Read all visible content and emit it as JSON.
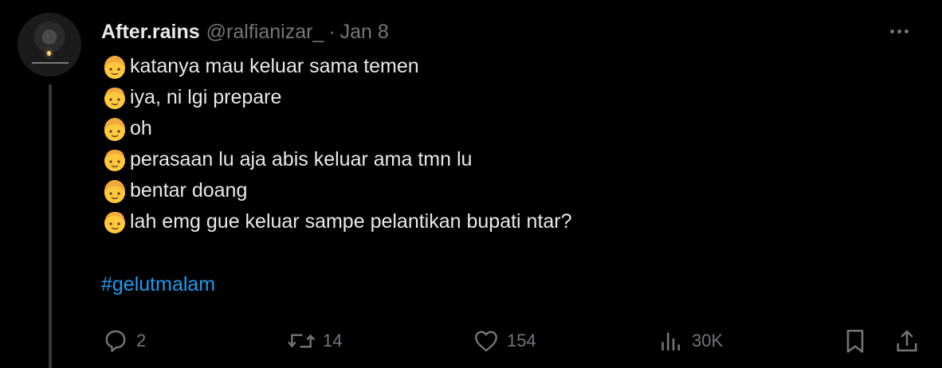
{
  "author": {
    "name": "After.rains",
    "handle": "@ralfianizar_",
    "separator": "·",
    "date": "Jan 8"
  },
  "tweet": {
    "lines": [
      {
        "speaker": "girl-emoji",
        "text": "katanya mau keluar sama temen"
      },
      {
        "speaker": "boy-emoji",
        "text": "iya, ni lgi prepare"
      },
      {
        "speaker": "girl-emoji",
        "text": "oh"
      },
      {
        "speaker": "boy-emoji",
        "text": "perasaan lu aja abis keluar ama tmn lu"
      },
      {
        "speaker": "girl-emoji",
        "text": "bentar doang"
      },
      {
        "speaker": "boy-emoji",
        "text": "lah emg gue keluar sampe pelantikan bupati ntar?"
      }
    ],
    "hashtag": "#gelutmalam"
  },
  "actions": {
    "replies": "2",
    "reposts": "14",
    "likes": "154",
    "views": "30K"
  },
  "colors": {
    "background": "#000000",
    "text": "#e7e9ea",
    "muted": "#71767b",
    "link": "#1d9bf0",
    "emoji": "#ffc83d"
  }
}
